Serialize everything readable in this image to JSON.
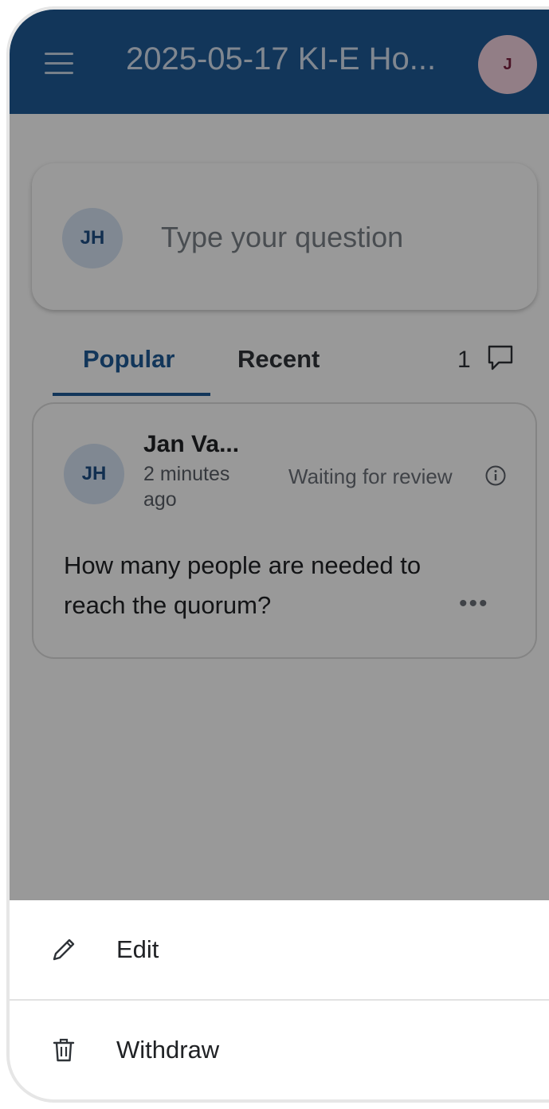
{
  "header": {
    "title": "2025-05-17 KI-E Ho...",
    "user_initial": "J",
    "menu_icon": "hamburger-menu-icon"
  },
  "question_input": {
    "avatar_initials": "JH",
    "placeholder": "Type your question"
  },
  "tabs": {
    "items": [
      {
        "label": "Popular",
        "active": true
      },
      {
        "label": "Recent",
        "active": false
      }
    ],
    "question_count": "1",
    "count_icon": "comment-icon"
  },
  "question_card": {
    "avatar_initials": "JH",
    "author": "Jan Va...",
    "timestamp": "2 minutes ago",
    "status": "Waiting for review",
    "status_icon": "info-icon",
    "text": "How many people are needed to reach the quorum?",
    "more_label": "•••"
  },
  "action_sheet": {
    "items": [
      {
        "label": "Edit",
        "icon": "pencil-icon"
      },
      {
        "label": "Withdraw",
        "icon": "trash-icon"
      }
    ]
  },
  "colors": {
    "brand": "#1f5a96",
    "user_avatar_bg": "#f3d3df",
    "initials_avatar_bg": "#d5e3f3"
  }
}
